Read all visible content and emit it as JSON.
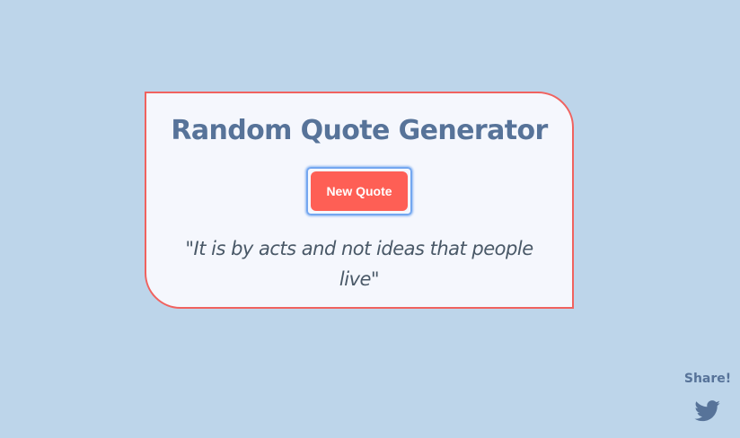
{
  "app": {
    "title": "Random Quote Generator"
  },
  "actions": {
    "new_quote_label": "New Quote"
  },
  "quote": {
    "text": "\"It is by acts and not ideas that people live\""
  },
  "share": {
    "label": "Share!",
    "icon": "twitter-icon"
  },
  "colors": {
    "background": "#bdd5ea",
    "card": "#f5f7fd",
    "accent": "#f0625f",
    "button": "#fe5f55",
    "title": "#577399",
    "quote": "#495867"
  }
}
